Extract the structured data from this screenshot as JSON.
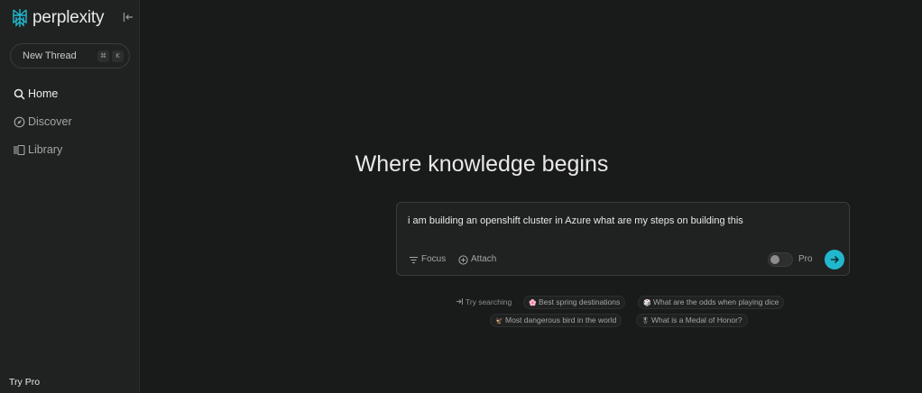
{
  "app": {
    "brand": "perplexity",
    "accent_color": "#21b8cd"
  },
  "sidebar": {
    "collapse_icon": "collapse-left-icon",
    "new_thread": {
      "label": "New Thread",
      "shortcut_keys": [
        "⌘",
        "K"
      ]
    },
    "nav": [
      {
        "label": "Home",
        "icon": "search-icon",
        "active": true
      },
      {
        "label": "Discover",
        "icon": "compass-icon",
        "active": false
      },
      {
        "label": "Library",
        "icon": "library-icon",
        "active": false
      }
    ],
    "footer": "Try Pro"
  },
  "main": {
    "headline": "Where knowledge begins",
    "search": {
      "value": "i am building an openshift cluster in Azure what are my steps on building this",
      "focus_label": "Focus",
      "attach_label": "Attach",
      "pro_label": "Pro",
      "pro_enabled": false
    },
    "suggestions": {
      "hint": "Try searching",
      "items": [
        {
          "emoji": "🌸",
          "label": "Best spring destinations"
        },
        {
          "emoji": "🎲",
          "label": "What are the odds when playing dice"
        },
        {
          "emoji": "🦅",
          "label": "Most dangerous bird in the world"
        },
        {
          "emoji": "🎖",
          "label": "What is a Medal of Honor?"
        }
      ]
    }
  }
}
